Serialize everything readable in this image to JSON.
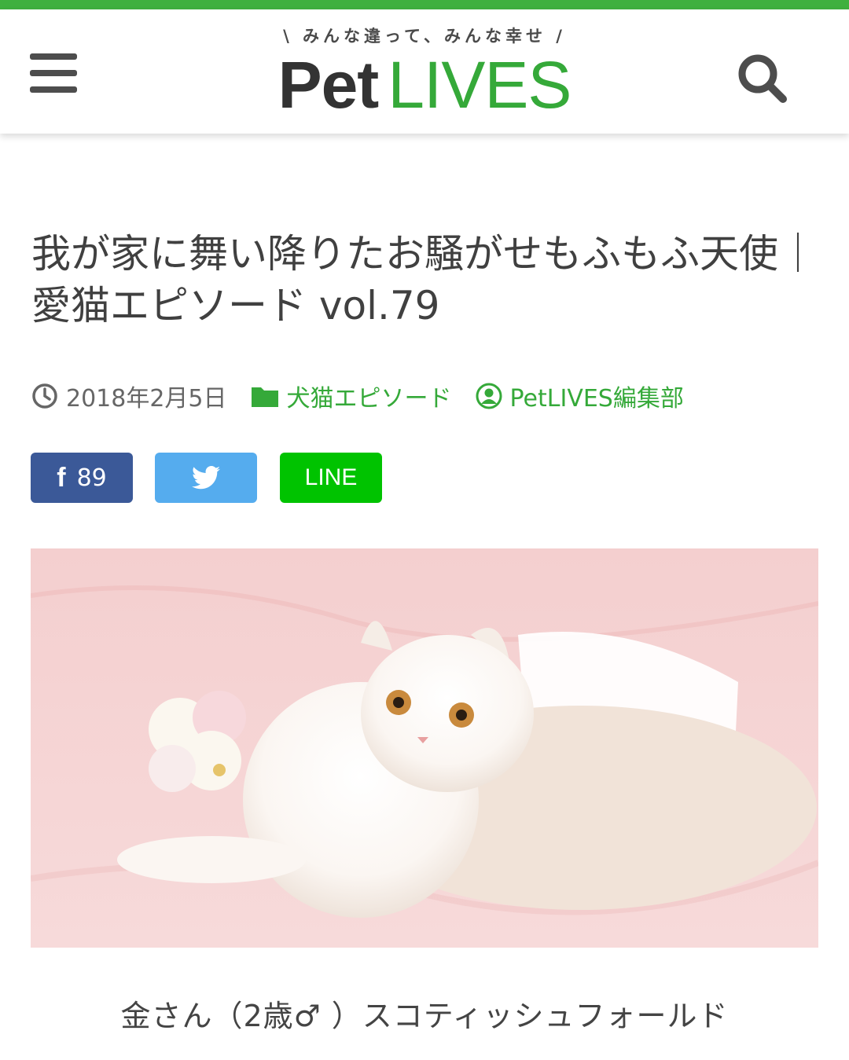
{
  "header": {
    "tagline": "\\ みんな違って、みんな幸せ /",
    "logo_pet": "Pet",
    "logo_lives": "LIVES",
    "menu_icon": "hamburger-icon",
    "search_icon": "search-icon"
  },
  "article": {
    "title": "我が家に舞い降りたお騒がせもふもふ天使｜愛猫エピソード vol.79",
    "date": "2018年2月5日",
    "category": "犬猫エピソード",
    "author": "PetLIVES編集部"
  },
  "share": {
    "facebook_count": "89",
    "line_label": "LINE"
  },
  "caption": "金さん（2歳♂ ）スコティッシュフォールド",
  "colors": {
    "brand_green": "#35a939",
    "facebook": "#3b5998",
    "twitter": "#55acee",
    "line": "#00c300"
  }
}
